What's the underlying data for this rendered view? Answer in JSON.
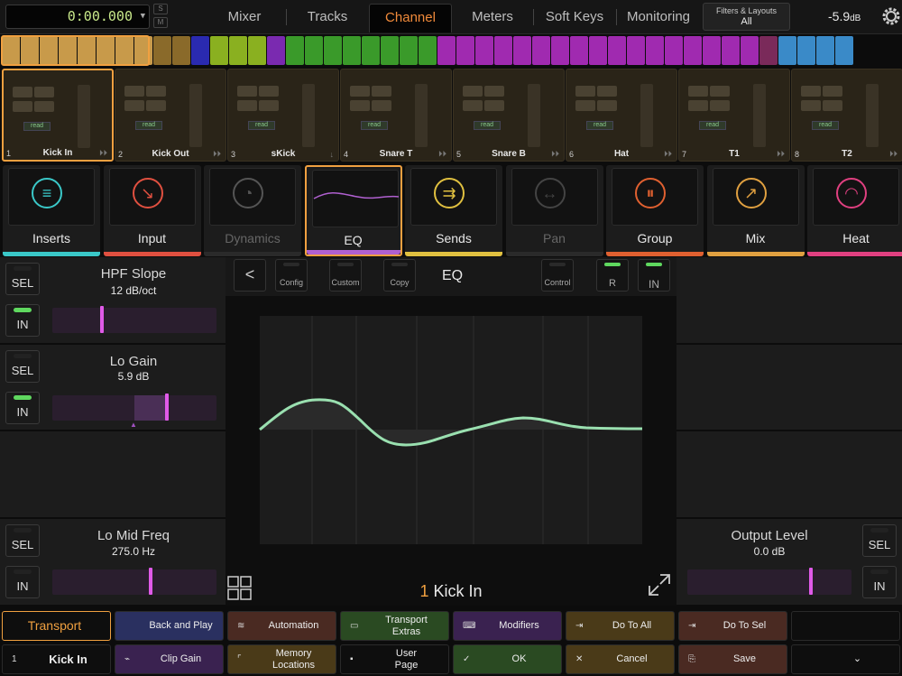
{
  "top": {
    "counter": "0:00.000",
    "s_label": "S",
    "m_label": "M",
    "tabs": [
      "Mixer",
      "Tracks",
      "Channel",
      "Meters",
      "Soft Keys",
      "Monitoring"
    ],
    "filters_label": "Filters & Layouts",
    "filters_value": "All",
    "level": "-5.9",
    "level_unit": "dB"
  },
  "strip_colors": [
    "#c89a4a",
    "#8a6a2a",
    "#2a2ab0",
    "#8ab020",
    "#7a2ab0",
    "#3a9a2a",
    "#a02ab0",
    "#7a2a5a",
    "#3a8ac8"
  ],
  "channels": [
    {
      "num": "1",
      "name": "Kick In"
    },
    {
      "num": "2",
      "name": "Kick Out"
    },
    {
      "num": "3",
      "name": "sKick"
    },
    {
      "num": "4",
      "name": "Snare T"
    },
    {
      "num": "5",
      "name": "Snare B"
    },
    {
      "num": "6",
      "name": "Hat"
    },
    {
      "num": "7",
      "name": "T1"
    },
    {
      "num": "8",
      "name": "T2"
    }
  ],
  "read_label": "read",
  "sections": [
    {
      "label": "Inserts",
      "color": "#3ac8c8"
    },
    {
      "label": "Input",
      "color": "#e05040"
    },
    {
      "label": "Dynamics",
      "color": "#555555"
    },
    {
      "label": "EQ",
      "color": "#b060d0"
    },
    {
      "label": "Sends",
      "color": "#e0c040"
    },
    {
      "label": "Pan",
      "color": "#444444"
    },
    {
      "label": "Group",
      "color": "#e06030"
    },
    {
      "label": "Mix",
      "color": "#e0a040"
    },
    {
      "label": "Heat",
      "color": "#e04080"
    }
  ],
  "params": {
    "hpf": {
      "name": "HPF Slope",
      "value": "12 dB/oct",
      "level": 0.3
    },
    "lo_gain": {
      "name": "Lo Gain",
      "value": "5.9 dB",
      "level": 0.7
    },
    "lo_mid": {
      "name": "Lo Mid Freq",
      "value": "275.0 Hz",
      "level": 0.6
    },
    "output": {
      "name": "Output Level",
      "value": "0.0 dB",
      "level": 0.75
    }
  },
  "sel_label": "SEL",
  "in_label": "IN",
  "eq": {
    "title": "EQ",
    "back": "<",
    "config": "Config",
    "custom": "Custom",
    "copy": "Copy",
    "control": "Control",
    "r": "R",
    "in": "IN",
    "channel_num": "1",
    "channel_name": "Kick In"
  },
  "bottom": [
    {
      "label": "Transport",
      "icon": ""
    },
    {
      "label": "Back and Play",
      "icon": ""
    },
    {
      "label": "Automation",
      "icon": "≋"
    },
    {
      "label": "Transport\nExtras",
      "icon": "▭"
    },
    {
      "label": "Modifiers",
      "icon": "⌨"
    },
    {
      "label": "Do To All",
      "icon": "⇥"
    },
    {
      "label": "Do To Sel",
      "icon": "⇥"
    },
    {
      "label": "",
      "icon": ""
    },
    {
      "label": "Kick In",
      "icon": "1"
    },
    {
      "label": "Clip Gain",
      "icon": "⌁"
    },
    {
      "label": "Memory\nLocations",
      "icon": "⌜"
    },
    {
      "label": "User\nPage",
      "icon": "▪"
    },
    {
      "label": "OK",
      "icon": "✓"
    },
    {
      "label": "Cancel",
      "icon": "✕"
    },
    {
      "label": "Save",
      "icon": "⎘"
    },
    {
      "label": "⌄",
      "icon": ""
    }
  ]
}
